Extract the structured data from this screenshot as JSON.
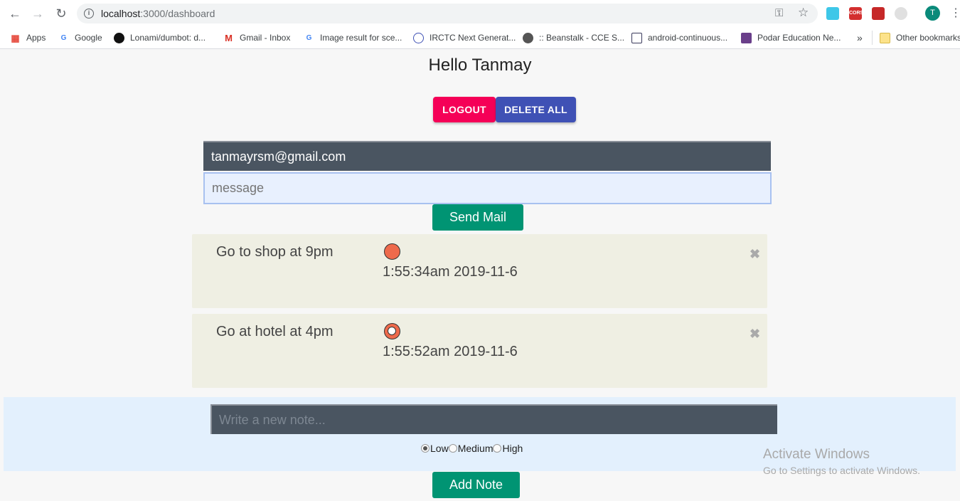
{
  "browser": {
    "url_host": "localhost",
    "url_path": ":3000/dashboard",
    "profile_initial": "T",
    "bookmarks": [
      {
        "label": "Apps",
        "icon": "apps-grid-icon"
      },
      {
        "label": "Google",
        "icon": "google-icon"
      },
      {
        "label": "Lonami/dumbot: d...",
        "icon": "github-icon"
      },
      {
        "label": "Gmail - Inbox",
        "icon": "gmail-icon"
      },
      {
        "label": "Image result for sce...",
        "icon": "google-icon"
      },
      {
        "label": "IRCTC Next Generat...",
        "icon": "irctc-icon"
      },
      {
        "label": ":: Beanstalk - CCE S...",
        "icon": "globe-icon"
      },
      {
        "label": "android-continuous...",
        "icon": "doc-icon"
      },
      {
        "label": "Podar Education Ne...",
        "icon": "podar-icon"
      }
    ],
    "overflow_label": "»",
    "other_bookmarks": "Other bookmarks",
    "ext_cors": "CORS"
  },
  "page": {
    "greeting": "Hello Tanmay",
    "logout_label": "LOGOUT",
    "delete_all_label": "DELETE ALL",
    "email_value": "tanmayrsm@gmail.com",
    "message_placeholder": "message",
    "send_label": "Send Mail"
  },
  "notes": [
    {
      "text": "Go to shop at 9pm",
      "time": "1:55:34am 2019-11-6",
      "priority": "low"
    },
    {
      "text": "Go at hotel at 4pm",
      "time": "1:55:52am 2019-11-6",
      "priority": "medium"
    }
  ],
  "new_note": {
    "placeholder": "Write a new note...",
    "priority_options": [
      "Low",
      "Medium",
      "High"
    ],
    "selected_priority": "Low",
    "add_label": "Add Note"
  },
  "watermark": {
    "line1": "Activate Windows",
    "line2": "Go to Settings to activate Windows."
  }
}
